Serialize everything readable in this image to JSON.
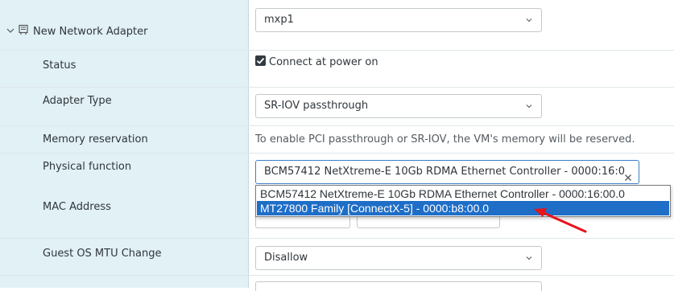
{
  "section": {
    "title": "New Network Adapter"
  },
  "network": {
    "value": "mxp1"
  },
  "status": {
    "label": "Status",
    "checkbox_label": "Connect at power on",
    "checked": true
  },
  "adapter_type": {
    "label": "Adapter Type",
    "value": "SR-IOV passthrough"
  },
  "memory_reservation": {
    "label": "Memory reservation",
    "note": "To enable PCI passthrough or SR-IOV, the VM's memory will be reserved."
  },
  "physical_function": {
    "label": "Physical function",
    "value": "BCM57412 NetXtreme-E 10Gb RDMA Ethernet Controller - 0000:16:0",
    "options": [
      "BCM57412 NetXtreme-E 10Gb RDMA Ethernet Controller - 0000:16:00.0",
      "MT27800 Family [ConnectX-5] - 0000:b8:00.0"
    ],
    "highlighted_index": 1
  },
  "mac_address": {
    "label": "MAC Address"
  },
  "guest_mtu": {
    "label": "Guest OS MTU Change",
    "value": "Disallow"
  },
  "colors": {
    "label_column_bg": "#e1f1f6",
    "highlight": "#1e6ec7",
    "annotation_arrow": "#e8131b"
  }
}
